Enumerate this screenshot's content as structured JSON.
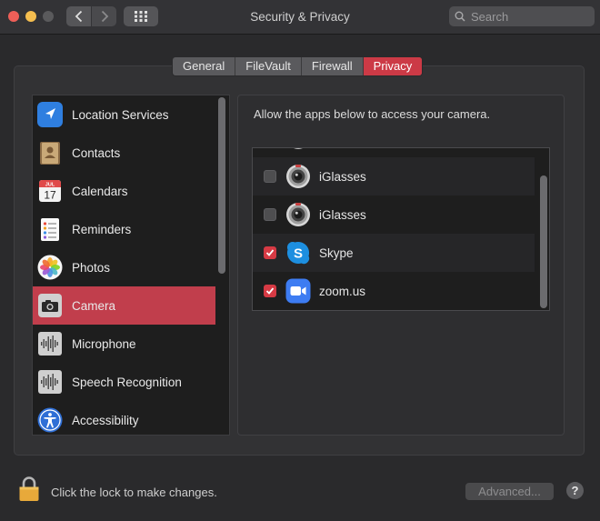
{
  "window": {
    "title": "Security & Privacy",
    "search_placeholder": "Search"
  },
  "tabs": [
    {
      "label": "General",
      "active": false
    },
    {
      "label": "FileVault",
      "active": false
    },
    {
      "label": "Firewall",
      "active": false
    },
    {
      "label": "Privacy",
      "active": true
    }
  ],
  "sidebar": {
    "items": [
      {
        "label": "Location Services",
        "icon": "location-arrow-icon",
        "selected": false
      },
      {
        "label": "Contacts",
        "icon": "contacts-book-icon",
        "selected": false
      },
      {
        "label": "Calendars",
        "icon": "calendar-icon",
        "selected": false
      },
      {
        "label": "Reminders",
        "icon": "reminders-list-icon",
        "selected": false
      },
      {
        "label": "Photos",
        "icon": "photos-flower-icon",
        "selected": false
      },
      {
        "label": "Camera",
        "icon": "camera-icon",
        "selected": true
      },
      {
        "label": "Microphone",
        "icon": "waveform-icon",
        "selected": false
      },
      {
        "label": "Speech Recognition",
        "icon": "waveform-icon",
        "selected": false
      },
      {
        "label": "Accessibility",
        "icon": "accessibility-icon",
        "selected": false
      }
    ],
    "calendar_icon_text": {
      "month": "JUL",
      "day": "17"
    }
  },
  "main": {
    "prompt": "Allow the apps below to access your camera.",
    "apps": [
      {
        "label": "iGlasses",
        "icon": "webcam-icon",
        "checked": false
      },
      {
        "label": "iGlasses",
        "icon": "webcam-icon",
        "checked": false
      },
      {
        "label": "Skype",
        "icon": "skype-icon",
        "checked": true
      },
      {
        "label": "zoom.us",
        "icon": "zoom-video-icon",
        "checked": true
      }
    ]
  },
  "footer": {
    "lock_text": "Click the lock to make changes.",
    "advanced_label": "Advanced...",
    "help_label": "?"
  },
  "colors": {
    "accent": "#cc3a46",
    "background": "#2a2a2c",
    "list_background": "#1e1e1e"
  }
}
